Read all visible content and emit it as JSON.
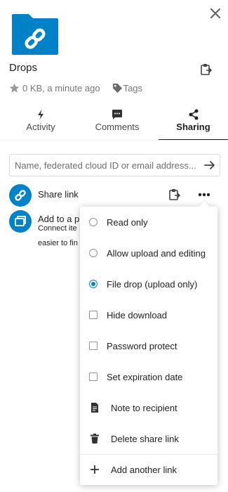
{
  "sidebar": {
    "file_name": "Drops",
    "size_text": "0 KB, a minute ago",
    "tags_label": "Tags"
  },
  "tabs": [
    {
      "label": "Activity",
      "icon": "activity-icon"
    },
    {
      "label": "Comments",
      "icon": "comments-icon"
    },
    {
      "label": "Sharing",
      "icon": "share-icon",
      "active": true
    }
  ],
  "search": {
    "placeholder": "Name, federated cloud ID or email address..."
  },
  "share_link": {
    "label": "Share link"
  },
  "collection": {
    "title": "Add to a p",
    "line1": "Connect ite",
    "line2": "easier to fin"
  },
  "menu": {
    "read_only": "Read only",
    "allow_upload": "Allow upload and editing",
    "file_drop": "File drop (upload only)",
    "hide_download": "Hide download",
    "password_protect": "Password protect",
    "set_expiration": "Set expiration date",
    "note_to_recipient": "Note to recipient",
    "delete_link": "Delete share link",
    "add_another": "Add another link",
    "selected_permission": "File drop (upload only)"
  },
  "colors": {
    "accent": "#0082c9",
    "text": "#222222",
    "muted": "#767676"
  }
}
